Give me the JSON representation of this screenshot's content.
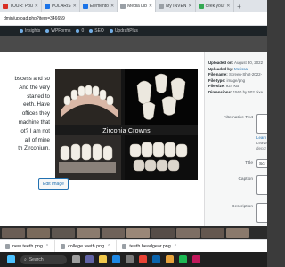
{
  "browser": {
    "tabs": [
      {
        "label": "TOUR: Pou",
        "color": "#d93025",
        "active": false
      },
      {
        "label": "POLARIS",
        "color": "#1a73e8",
        "active": false
      },
      {
        "label": "Elemento",
        "color": "#1a73e8",
        "active": false
      },
      {
        "label": "Media Lib",
        "color": "#9aa0a6",
        "active": true
      },
      {
        "label": "My INVEN",
        "color": "#9aa0a6",
        "active": false
      },
      {
        "label": "ceek your",
        "color": "#34a853",
        "active": false
      }
    ],
    "url": "dmin/upload.php?item=346659"
  },
  "admin_bar": {
    "items": [
      "Insights",
      "WPForms",
      "0",
      "SEO",
      "UpdraftPlus"
    ]
  },
  "modal": {
    "body_lines": [
      "bscess and so",
      "And the very",
      "started to",
      "eeth. Have",
      "l offices they",
      "machine that",
      "ot? I am not",
      "all of mine",
      "th Zirconium."
    ],
    "image_caption": "Zirconia Crowns",
    "edit_image_label": "Edit Image",
    "details": {
      "uploaded_on_label": "Uploaded on:",
      "uploaded_on": "August 30, 2022",
      "uploaded_by_label": "Uploaded by:",
      "uploaded_by": "Melissa",
      "file_name_label": "File name:",
      "file_name": "Screen-Shot-2022-",
      "file_type_label": "File type:",
      "file_type": "image/png",
      "file_size_label": "File size:",
      "file_size": "924 KB",
      "dimensions_label": "Dimensions:",
      "dimensions": "1560 by 602 pixe"
    },
    "fields": {
      "alt_label": "Alternative Text",
      "learn": "Learn",
      "hint1": "Leave",
      "hint2": "decor",
      "title_label": "Title",
      "title_value": "Scr",
      "caption_label": "Caption",
      "description_label": "Description"
    }
  },
  "downloads": [
    {
      "label": "new teeth.png"
    },
    {
      "label": "college teeth.png"
    },
    {
      "label": "teeth headgear.png"
    }
  ],
  "taskbar": {
    "search_placeholder": "Search"
  }
}
